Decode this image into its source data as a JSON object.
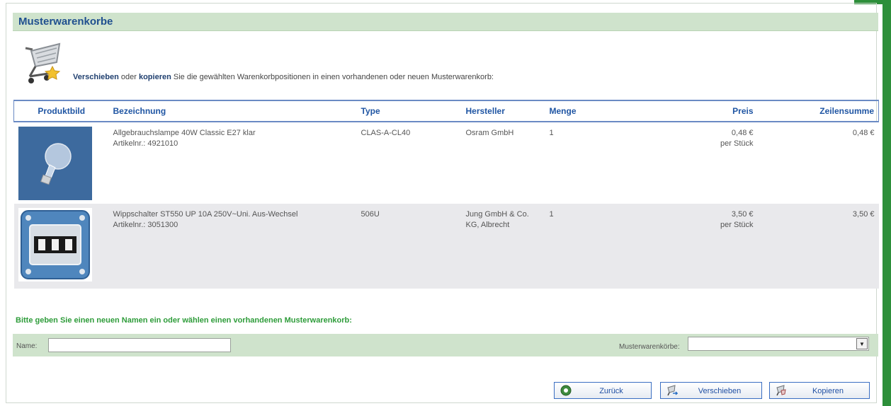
{
  "page": {
    "title": "Musterwarenkorbe"
  },
  "instruction": {
    "bold1": "Verschieben",
    "middle": " oder ",
    "bold2": "kopieren",
    "rest": " Sie die gewählten Warenkorbpositionen in einen vorhandenen oder neuen Musterwarenkorb:"
  },
  "table": {
    "headers": {
      "image": "Produktbild",
      "name": "Bezeichnung",
      "type": "Type",
      "manufacturer": "Hersteller",
      "quantity": "Menge",
      "price": "Preis",
      "line_total": "Zeilensumme"
    },
    "rows": [
      {
        "name": "Allgebrauchslampe 40W Classic E27 klar",
        "article": "Artikelnr.: 4921010",
        "type": "CLAS-A-CL40",
        "manufacturer": "Osram GmbH",
        "manufacturer2": "",
        "quantity": "1",
        "price": "0,48 €",
        "price_unit": "per Stück",
        "line_total": "0,48 €"
      },
      {
        "name": "Wippschalter ST550 UP 10A 250V~Uni. Aus-Wechsel",
        "article": "Artikelnr.: 3051300",
        "type": "506U",
        "manufacturer": "Jung GmbH & Co.",
        "manufacturer2": "KG, Albrecht",
        "quantity": "1",
        "price": "3,50 €",
        "price_unit": "per Stück",
        "line_total": "3,50 €"
      }
    ]
  },
  "form": {
    "prompt": "Bitte geben Sie einen neuen Namen ein oder wählen einen vorhandenen Musterwarenkorb:",
    "name_label": "Name:",
    "name_value": "",
    "baskets_label": "Musterwarenkörbe:",
    "baskets_selected": ""
  },
  "buttons": {
    "back": "Zurück",
    "move": "Verschieben",
    "copy": "Kopieren"
  },
  "colors": {
    "title_bar": "#cfe3cc",
    "title_text": "#1f4f8f",
    "header_text": "#1f55a3",
    "prompt_text": "#2e9c3a",
    "accent": "#2d8f3a"
  },
  "icons": {
    "cart": "shopping-cart-star-icon",
    "back": "back-icon",
    "move": "move-icon",
    "copy": "copy-icon"
  }
}
